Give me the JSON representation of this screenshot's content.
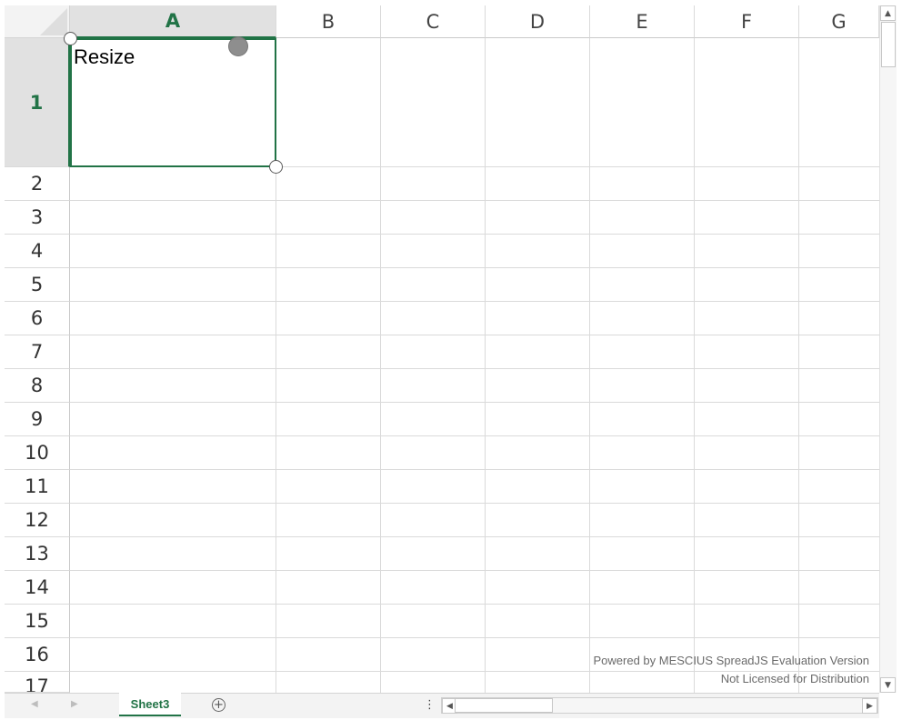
{
  "columns": [
    "A",
    "B",
    "C",
    "D",
    "E",
    "F",
    "G"
  ],
  "rows": [
    "1",
    "2",
    "3",
    "4",
    "5",
    "6",
    "7",
    "8",
    "9",
    "10",
    "11",
    "12",
    "13",
    "14",
    "15",
    "16",
    "17"
  ],
  "selected_cell": {
    "address": "A1",
    "value": "Resize"
  },
  "sheet_tabs": [
    {
      "label": "Sheet3",
      "active": true
    }
  ],
  "add_sheet_icon": "plus-circle-icon",
  "tab_options_icon": "vertical-ellipsis-icon",
  "watermark": {
    "line1": "Powered by MESCIUS SpreadJS Evaluation Version",
    "line2": "Not Licensed for Distribution"
  },
  "colors": {
    "accent": "#217346",
    "header_selected_bg": "#e1e1e1",
    "gridline": "#dadada"
  }
}
